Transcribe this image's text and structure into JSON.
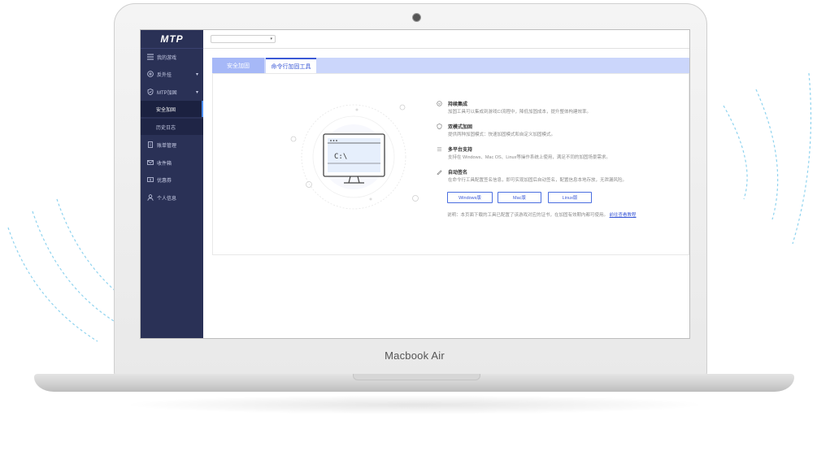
{
  "device": {
    "label": "Macbook Air"
  },
  "sidebar": {
    "logo": "MTP",
    "items": [
      {
        "label": "我的游戏",
        "icon": "menu-icon"
      },
      {
        "label": "反外挂",
        "icon": "shield-plus-icon"
      },
      {
        "label": "MTP加固",
        "icon": "shield-check-icon"
      },
      {
        "label": "安全加固",
        "sub": true,
        "active": true
      },
      {
        "label": "历史日志",
        "sub": true
      },
      {
        "label": "账单管理",
        "icon": "bill-icon"
      },
      {
        "label": "收件箱",
        "icon": "mail-icon"
      },
      {
        "label": "优惠券",
        "icon": "coupon-icon"
      },
      {
        "label": "个人信息",
        "icon": "user-icon"
      }
    ]
  },
  "topbar": {
    "game_select_value": ""
  },
  "tabs": [
    {
      "label": "安全加固",
      "active": false
    },
    {
      "label": "命令行加固工具",
      "active": true
    }
  ],
  "illustration": {
    "terminal_text": "C:\\"
  },
  "features": [
    {
      "title": "持续集成",
      "desc": "加固工具可以集成到游戏CI流程中，降低加固成本，提升整体构建效率。",
      "icon": "cycle-icon"
    },
    {
      "title": "双模式加固",
      "desc": "提供两种加固模式：快速加固模式和自定义加固模式。",
      "icon": "dual-mode-icon"
    },
    {
      "title": "多平台支持",
      "desc": "支持在 Windows、Mac OS、Linux等操作系统上使用，满足不同的加固场景需求。",
      "icon": "platform-icon"
    },
    {
      "title": "自动签名",
      "desc": "在命令行工具配置签名信息，即可实现加固后自动签名，配置信息本地存放，无泄漏风险。",
      "icon": "sign-icon"
    }
  ],
  "downloads": [
    {
      "label": "Windows版"
    },
    {
      "label": "Mac版"
    },
    {
      "label": "Linux版"
    }
  ],
  "note": {
    "text": "说明：本页面下载的工具已配置了该游戏对应的证书，在加固有效期内都可使用。",
    "link": "前往查看教程"
  },
  "colors": {
    "sidebar_bg": "#2a3156",
    "accent": "#3a58d6",
    "tab_bar": "#cbd6fb"
  }
}
